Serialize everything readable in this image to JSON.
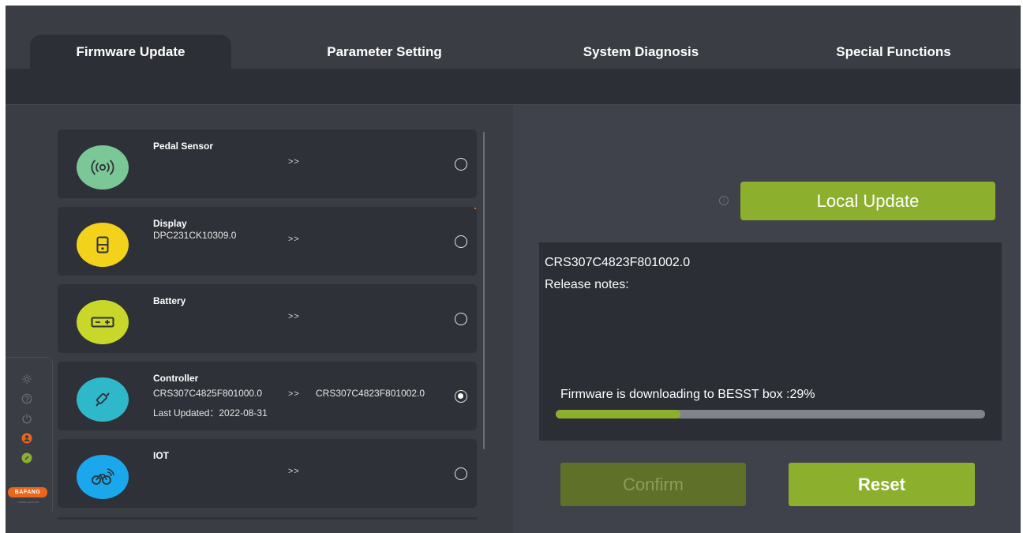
{
  "tabs": [
    {
      "label": "Firmware Update",
      "active": true
    },
    {
      "label": "Parameter Setting",
      "active": false
    },
    {
      "label": "System Diagnosis",
      "active": false
    },
    {
      "label": "Special Functions",
      "active": false
    }
  ],
  "devices": [
    {
      "name": "Pedal Sensor",
      "version": "",
      "arrow": ">>",
      "target": "",
      "last_updated": "",
      "icon": "signal-icon",
      "color": "#7cc796",
      "selected": false
    },
    {
      "name": "Display",
      "version": "DPC231CK10309.0",
      "arrow": ">>",
      "target": "",
      "last_updated": "",
      "icon": "display-icon",
      "color": "#f2d21b",
      "selected": false
    },
    {
      "name": "Battery",
      "version": "",
      "arrow": ">>",
      "target": "",
      "last_updated": "",
      "icon": "battery-icon",
      "color": "#c9d62a",
      "selected": false
    },
    {
      "name": "Controller",
      "version": "CRS307C4825F801000.0",
      "arrow": ">>",
      "target": "CRS307C4823F801002.0",
      "last_updated": "Last Updated：2022-08-31",
      "icon": "controller-icon",
      "color": "#2fb8c9",
      "selected": true
    },
    {
      "name": "IOT",
      "version": "",
      "arrow": ">>",
      "target": "",
      "last_updated": "",
      "icon": "bike-iot-icon",
      "color": "#1aa7ec",
      "selected": false
    }
  ],
  "rail": {
    "icons": [
      "settings-icon",
      "help-icon",
      "power-icon",
      "user-icon",
      "link-icon"
    ],
    "brand": "BAFANG",
    "brand_sub": "motion your life"
  },
  "update_panel": {
    "local_update_label": "Local Update",
    "firmware_version": "CRS307C4823F801002.0",
    "release_notes_label": "Release notes:",
    "progress_text": "Firmware is downloading to BESST box :29%",
    "progress_fraction": 0.29,
    "confirm_label": "Confirm",
    "reset_label": "Reset",
    "confirm_enabled": false
  },
  "colors": {
    "accent_green": "#8daf2e",
    "accent_green_disabled": "#5f7028",
    "brand_orange": "#e8671c",
    "background": "#3a3d44",
    "panel_dark": "#2b2e34"
  }
}
